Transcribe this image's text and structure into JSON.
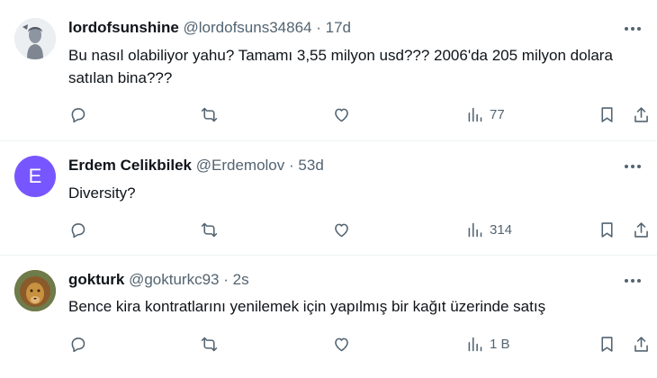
{
  "posts": [
    {
      "display_name": "lordofsunshine",
      "handle": "@lordofsuns34864",
      "separator": "·",
      "time": "17d",
      "text": "Bu nasıl olabiliyor yahu? Tamamı 3,55 milyon usd??? 2006'da 205 milyon dolara satılan bina???",
      "views": "77",
      "avatar": "statue-photo"
    },
    {
      "display_name": "Erdem Celikbilek",
      "handle": "@Erdemolov",
      "separator": "·",
      "time": "53d",
      "text": "Diversity?",
      "views": "314",
      "avatar_letter": "E",
      "avatar_color": "#7856ff"
    },
    {
      "display_name": "gokturk",
      "handle": "@gokturkc93",
      "separator": "·",
      "time": "2s",
      "text": "Bence kira kontratlarını yenilemek için yapılmış bir kağıt üzerinde satış",
      "views": "1 B",
      "avatar": "lion-photo"
    }
  ],
  "icons": [
    "more-icon",
    "reply-icon",
    "repost-icon",
    "like-icon",
    "views-icon",
    "bookmark-icon",
    "share-icon"
  ],
  "colors": {
    "text": "#0f1419",
    "secondary": "#536471",
    "divider": "#eff3f4"
  }
}
